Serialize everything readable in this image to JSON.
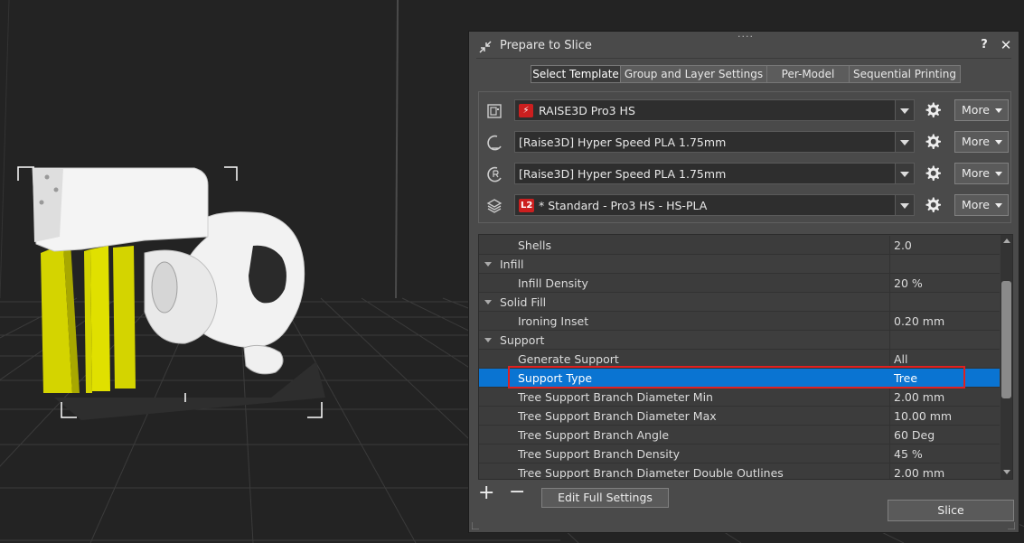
{
  "dialog": {
    "title": "Prepare to Slice",
    "help": "?",
    "close": "✕"
  },
  "tabs": [
    {
      "label": "Select Template"
    },
    {
      "label": "Group and Layer Settings"
    },
    {
      "label": "Per-Model"
    },
    {
      "label": "Sequential Printing"
    }
  ],
  "presets": {
    "printer": {
      "badge": "⚡",
      "value": "RAISE3D Pro3 HS",
      "icon": "printer-icon"
    },
    "left_material": {
      "value": "[Raise3D] Hyper Speed PLA 1.75mm",
      "icon": "left-extruder-icon"
    },
    "right_material": {
      "value": "[Raise3D] Hyper Speed PLA 1.75mm",
      "icon": "right-extruder-icon"
    },
    "profile": {
      "badge": "L2",
      "value": "* Standard - Pro3 HS - HS-PLA",
      "icon": "layers-icon"
    },
    "more_label": "More"
  },
  "settings": {
    "rows": [
      {
        "type": "item",
        "label": "Shells",
        "value": "2.0"
      },
      {
        "type": "group",
        "label": "Infill"
      },
      {
        "type": "item",
        "label": "Infill Density",
        "value": "20 %"
      },
      {
        "type": "group",
        "label": "Solid Fill"
      },
      {
        "type": "item",
        "label": "Ironing Inset",
        "value": "0.20 mm"
      },
      {
        "type": "group",
        "label": "Support"
      },
      {
        "type": "item",
        "label": "Generate Support",
        "value": "All"
      },
      {
        "type": "item",
        "label": "Support Type",
        "value": "Tree",
        "selected": true
      },
      {
        "type": "item",
        "label": "Tree Support Branch Diameter Min",
        "value": "2.00 mm"
      },
      {
        "type": "item",
        "label": "Tree Support Branch Diameter Max",
        "value": "10.00 mm"
      },
      {
        "type": "item",
        "label": "Tree Support Branch Angle",
        "value": "60 Deg"
      },
      {
        "type": "item",
        "label": "Tree Support Branch Density",
        "value": "45 %"
      },
      {
        "type": "item",
        "label": "Tree Support Branch Diameter Double Outlines",
        "value": "2.00 mm"
      }
    ]
  },
  "footer": {
    "add": "+",
    "remove": "−",
    "edit_full_settings": "Edit Full Settings",
    "slice": "Slice"
  },
  "colors": {
    "selection": "#0a74d2",
    "highlight_box": "#e02020",
    "model_body": "#ffffff",
    "support": "#d4d400",
    "badge_red": "#cc1f1f"
  }
}
